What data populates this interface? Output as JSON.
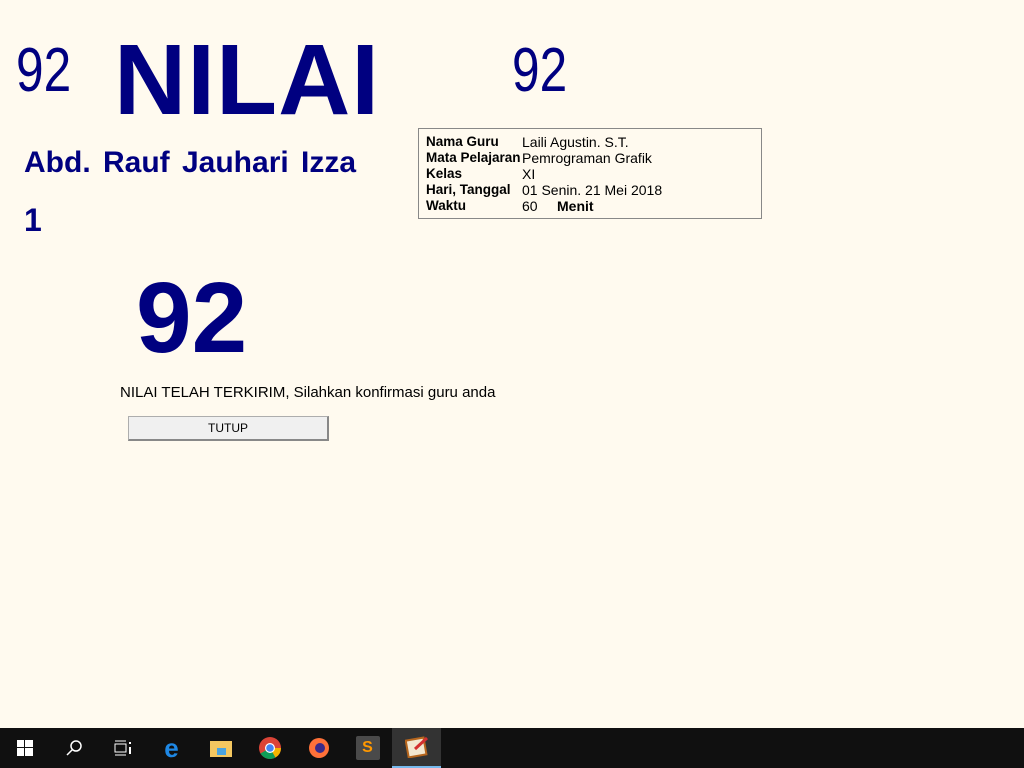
{
  "header": {
    "score_left": "92",
    "title": "NILAI",
    "score_right": "92"
  },
  "student": {
    "name": "Abd. Rauf Jauhari Izza",
    "number": "1"
  },
  "result": {
    "score": "92",
    "message": "NILAI TELAH TERKIRIM, Silahkan konfirmasi guru anda",
    "close_label": "TUTUP"
  },
  "info": {
    "rows": [
      {
        "label": "Nama Guru",
        "value": "Laili Agustin. S.T."
      },
      {
        "label": "Mata Pelajaran",
        "value": "Pemrograman Grafik"
      },
      {
        "label": "Kelas",
        "value": "XI"
      },
      {
        "label": "Hari, Tanggal",
        "value": "01 Senin. 21 Mei 2018"
      },
      {
        "label": "Waktu",
        "value": "60",
        "unit": "Menit"
      }
    ]
  },
  "taskbar": {
    "icons": [
      "windows-start-icon",
      "search-icon",
      "task-view-icon",
      "edge-icon",
      "file-explorer-icon",
      "chrome-icon",
      "firefox-icon",
      "sublime-text-icon",
      "exam-app-icon"
    ]
  }
}
